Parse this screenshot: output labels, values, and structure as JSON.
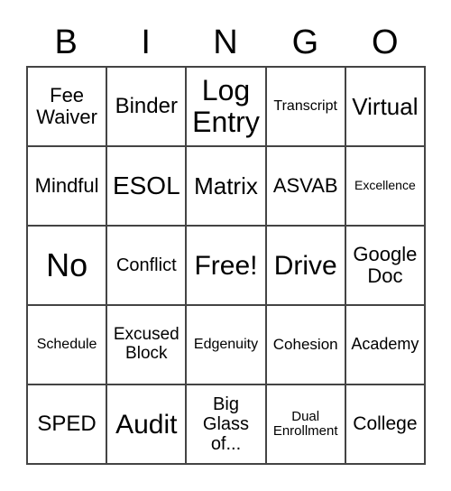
{
  "header": [
    "B",
    "I",
    "N",
    "G",
    "O"
  ],
  "cells": [
    "Fee Waiver",
    "Binder",
    "Log Entry",
    "Transcript",
    "Virtual",
    "Mindful",
    "ESOL",
    "Matrix",
    "ASVAB",
    "Excellence",
    "No",
    "Conflict",
    "Free!",
    "Drive",
    "Google Doc",
    "Schedule",
    "Excused Block",
    "Edgenuity",
    "Cohesion",
    "Academy",
    "SPED",
    "Audit",
    "Big Glass of...",
    "Dual Enrollment",
    "College"
  ]
}
